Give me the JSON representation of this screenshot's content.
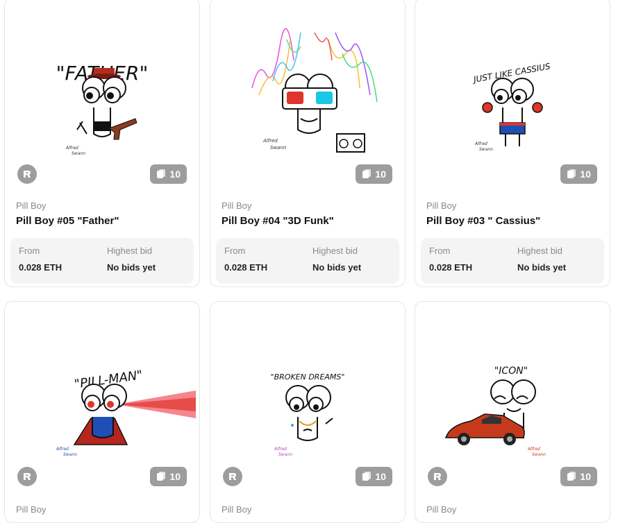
{
  "cards": [
    {
      "collection": "Pill Boy",
      "title": "Pill Boy #05 \"Father\"",
      "art_text": "\"FATHER\"",
      "edition": "10",
      "from_label": "From",
      "price": "0.028 ETH",
      "bid_label": "Highest bid",
      "bid": "No bids yet"
    },
    {
      "collection": "Pill Boy",
      "title": "Pill Boy #04 \"3D Funk\"",
      "art_text": "",
      "edition": "10",
      "from_label": "From",
      "price": "0.028 ETH",
      "bid_label": "Highest bid",
      "bid": "No bids yet"
    },
    {
      "collection": "Pill Boy",
      "title": "Pill Boy #03 \" Cassius\"",
      "art_text": "JUST LIKE CASSIUS",
      "edition": "10",
      "from_label": "From",
      "price": "0.028 ETH",
      "bid_label": "Highest bid",
      "bid": "No bids yet"
    },
    {
      "collection": "Pill Boy",
      "art_text": "\"PILL-MAN\"",
      "edition": "10"
    },
    {
      "collection": "Pill Boy",
      "art_text": "\"BROKEN DREAMS\"",
      "edition": "10"
    },
    {
      "collection": "Pill Boy",
      "art_text": "\"ICON\"",
      "edition": "10"
    }
  ],
  "colors": {
    "badge": "#9d9d9d",
    "price_box": "#f4f4f4",
    "red": "#e0352b",
    "cyan": "#19c7e6",
    "cape": "#b5261e",
    "blue": "#1f4fb5"
  }
}
